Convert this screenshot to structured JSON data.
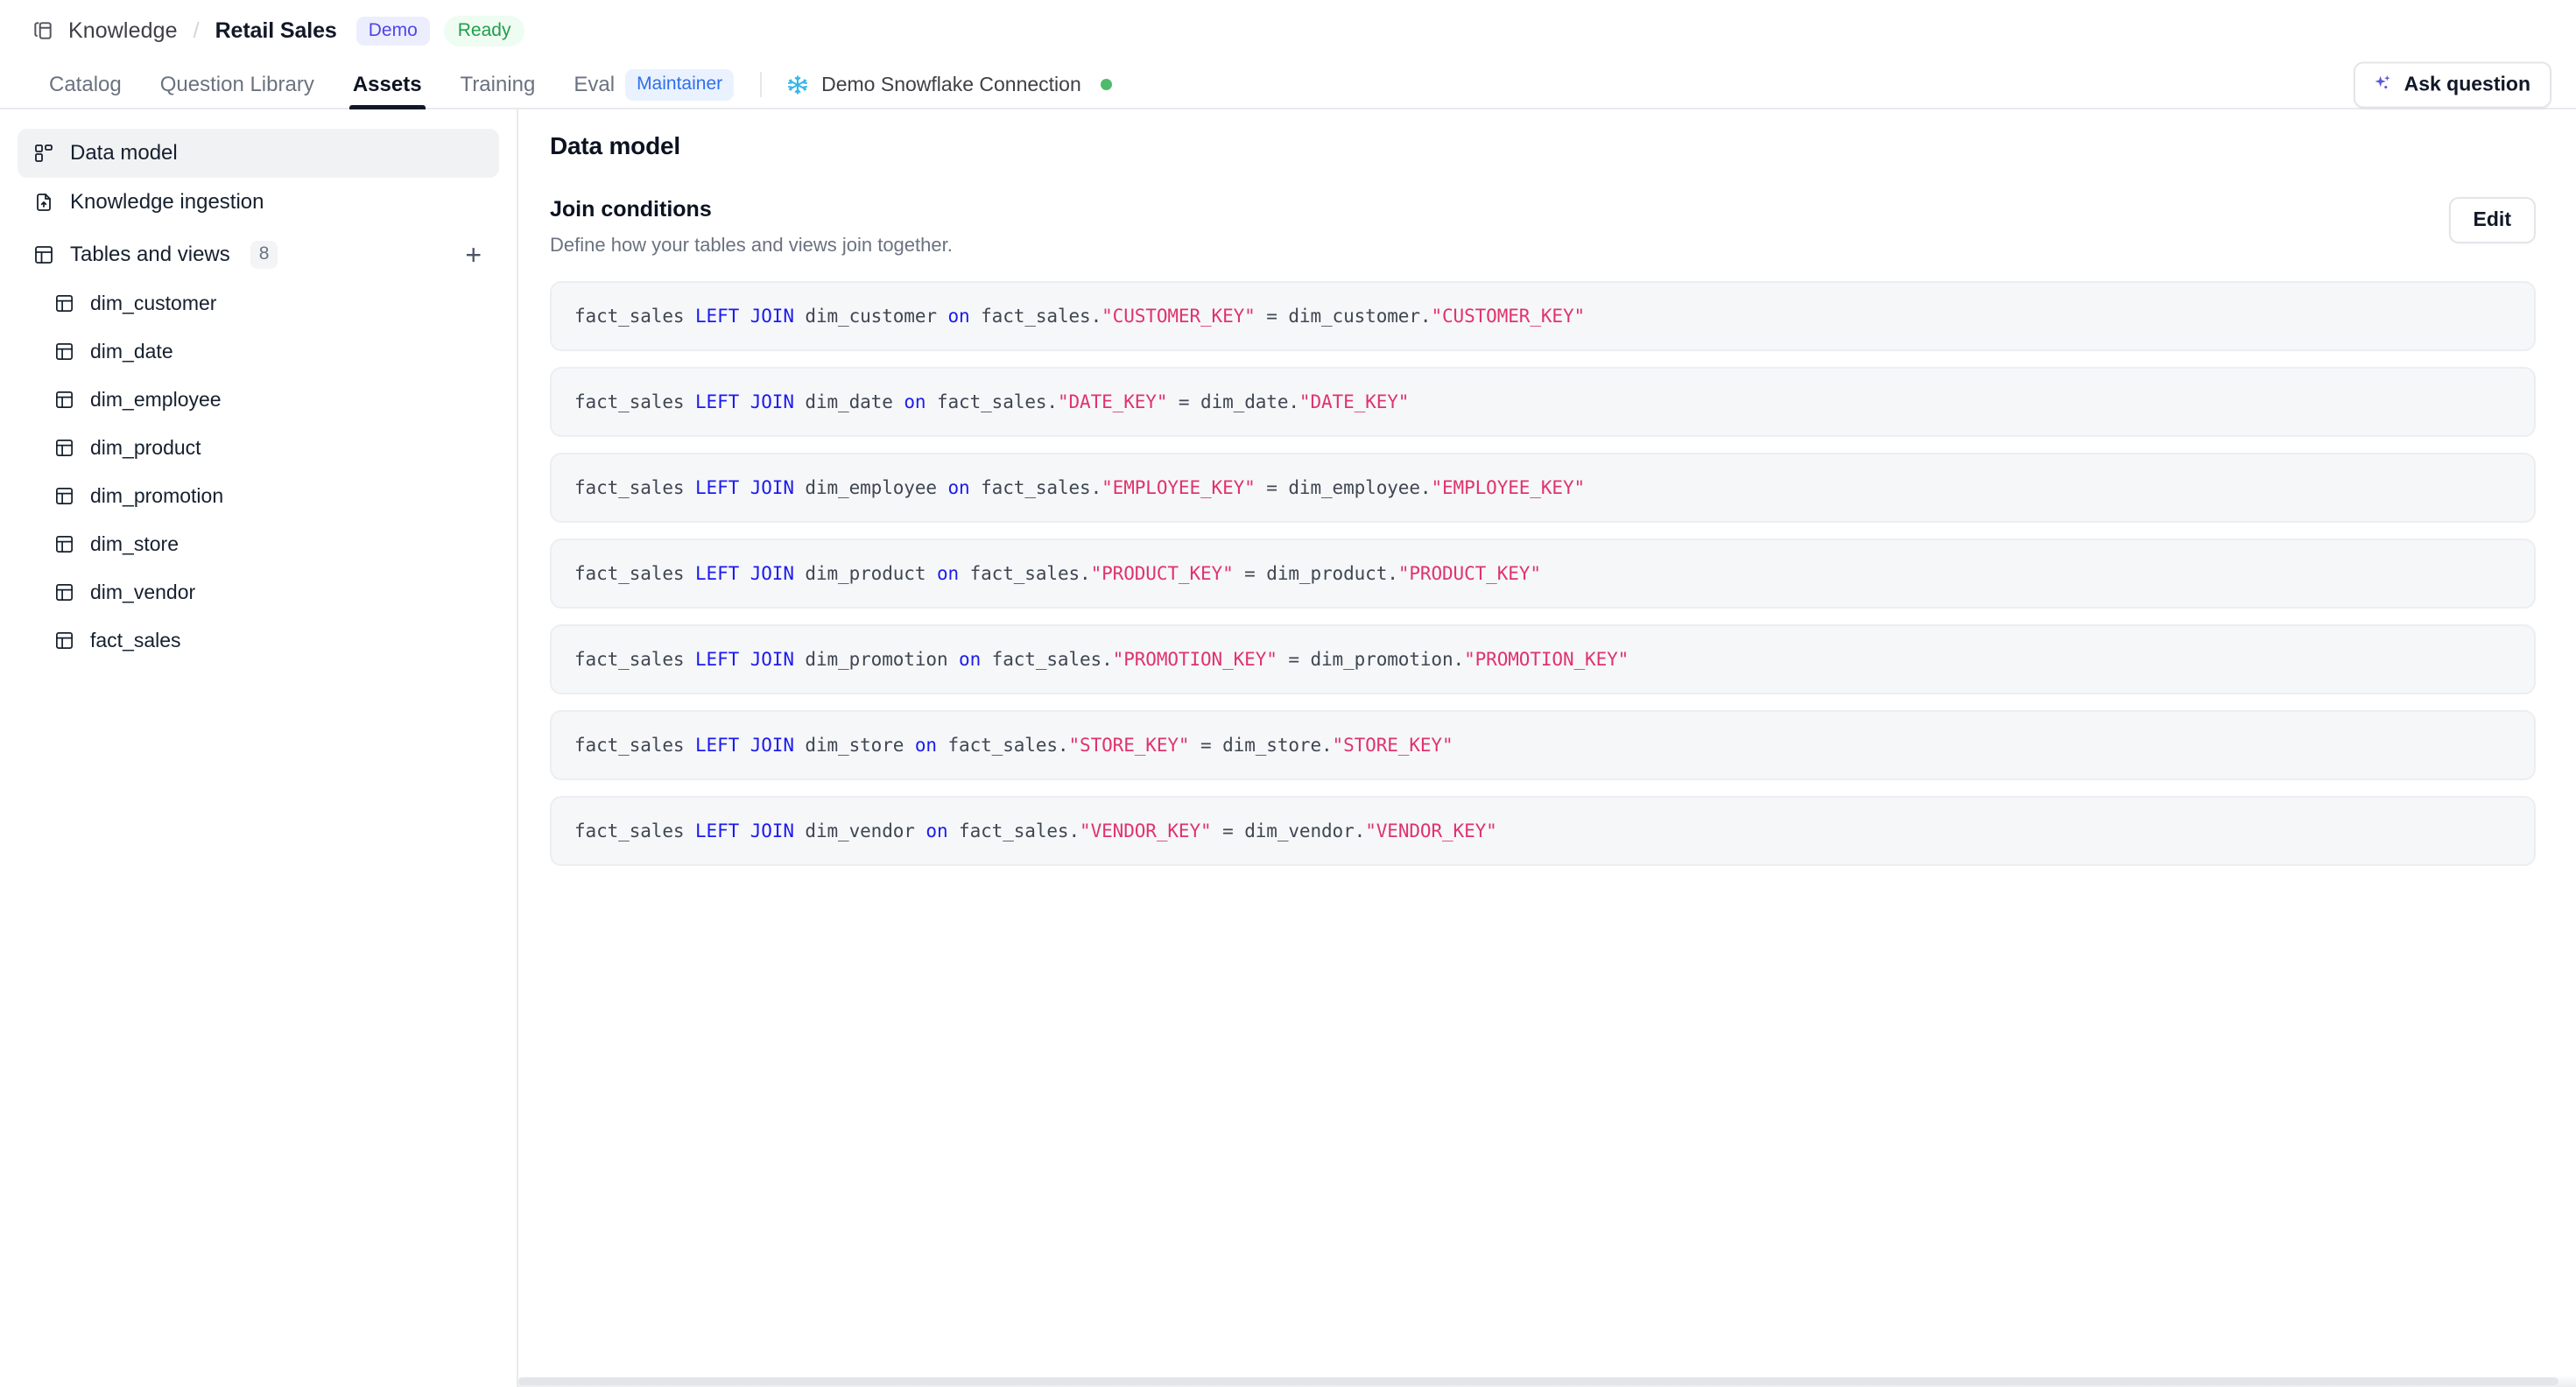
{
  "breadcrumb": {
    "icon": "library-copy-icon",
    "root_label": "Knowledge",
    "separator": "/",
    "current_label": "Retail Sales",
    "badges": [
      {
        "label": "Demo",
        "color": "#4f46e5",
        "bg": "#eceefe"
      },
      {
        "label": "Ready",
        "color": "#1f9e4c",
        "bg": "#eefcf1"
      }
    ]
  },
  "tabs": [
    {
      "label": "Catalog",
      "active": false
    },
    {
      "label": "Question Library",
      "active": false
    },
    {
      "label": "Assets",
      "active": true
    },
    {
      "label": "Training",
      "active": false
    },
    {
      "label": "Eval",
      "active": false,
      "badge": "Maintainer"
    }
  ],
  "connection": {
    "icon": "snowflake-icon",
    "label": "Demo Snowflake Connection",
    "status_color": "#4fba6b",
    "icon_color": "#35b7ea"
  },
  "ask_button": {
    "label": "Ask question",
    "icon": "sparkle-icon",
    "icon_color": "#5b5bd6"
  },
  "sidebar": {
    "items": [
      {
        "label": "Data model",
        "icon": "layout-dashboard-icon",
        "active": true
      },
      {
        "label": "Knowledge ingestion",
        "icon": "file-upload-icon",
        "active": false
      }
    ],
    "group": {
      "label": "Tables and views",
      "icon": "table-icon",
      "count": "8",
      "add_label": "+"
    },
    "tables": [
      {
        "label": "dim_customer",
        "icon": "table-icon"
      },
      {
        "label": "dim_date",
        "icon": "table-icon"
      },
      {
        "label": "dim_employee",
        "icon": "table-icon"
      },
      {
        "label": "dim_product",
        "icon": "table-icon"
      },
      {
        "label": "dim_promotion",
        "icon": "table-icon"
      },
      {
        "label": "dim_store",
        "icon": "table-icon"
      },
      {
        "label": "dim_vendor",
        "icon": "table-icon"
      },
      {
        "label": "fact_sales",
        "icon": "table-icon"
      }
    ]
  },
  "main": {
    "title": "Data model",
    "section_title": "Join conditions",
    "section_subtitle": "Define how your tables and views join together.",
    "edit_label": "Edit",
    "join_conditions": [
      {
        "left_table": "fact_sales",
        "keyword": "LEFT JOIN",
        "right_table": "dim_customer",
        "on": "on",
        "left_expr_table": "fact_sales",
        "left_expr_col": "\"CUSTOMER_KEY\"",
        "eq": "=",
        "right_expr_table": "dim_customer",
        "right_expr_col": "\"CUSTOMER_KEY\""
      },
      {
        "left_table": "fact_sales",
        "keyword": "LEFT JOIN",
        "right_table": "dim_date",
        "on": "on",
        "left_expr_table": "fact_sales",
        "left_expr_col": "\"DATE_KEY\"",
        "eq": "=",
        "right_expr_table": "dim_date",
        "right_expr_col": "\"DATE_KEY\""
      },
      {
        "left_table": "fact_sales",
        "keyword": "LEFT JOIN",
        "right_table": "dim_employee",
        "on": "on",
        "left_expr_table": "fact_sales",
        "left_expr_col": "\"EMPLOYEE_KEY\"",
        "eq": "=",
        "right_expr_table": "dim_employee",
        "right_expr_col": "\"EMPLOYEE_KEY\""
      },
      {
        "left_table": "fact_sales",
        "keyword": "LEFT JOIN",
        "right_table": "dim_product",
        "on": "on",
        "left_expr_table": "fact_sales",
        "left_expr_col": "\"PRODUCT_KEY\"",
        "eq": "=",
        "right_expr_table": "dim_product",
        "right_expr_col": "\"PRODUCT_KEY\""
      },
      {
        "left_table": "fact_sales",
        "keyword": "LEFT JOIN",
        "right_table": "dim_promotion",
        "on": "on",
        "left_expr_table": "fact_sales",
        "left_expr_col": "\"PROMOTION_KEY\"",
        "eq": "=",
        "right_expr_table": "dim_promotion",
        "right_expr_col": "\"PROMOTION_KEY\""
      },
      {
        "left_table": "fact_sales",
        "keyword": "LEFT JOIN",
        "right_table": "dim_store",
        "on": "on",
        "left_expr_table": "fact_sales",
        "left_expr_col": "\"STORE_KEY\"",
        "eq": "=",
        "right_expr_table": "dim_store",
        "right_expr_col": "\"STORE_KEY\""
      },
      {
        "left_table": "fact_sales",
        "keyword": "LEFT JOIN",
        "right_table": "dim_vendor",
        "on": "on",
        "left_expr_table": "fact_sales",
        "left_expr_col": "\"VENDOR_KEY\"",
        "eq": "=",
        "right_expr_table": "dim_vendor",
        "right_expr_col": "\"VENDOR_KEY\""
      }
    ]
  },
  "theme": {
    "keyword_color": "#1b1bef",
    "string_color": "#e0336b",
    "code_bg": "#f6f7f9",
    "accent": "#111827"
  }
}
